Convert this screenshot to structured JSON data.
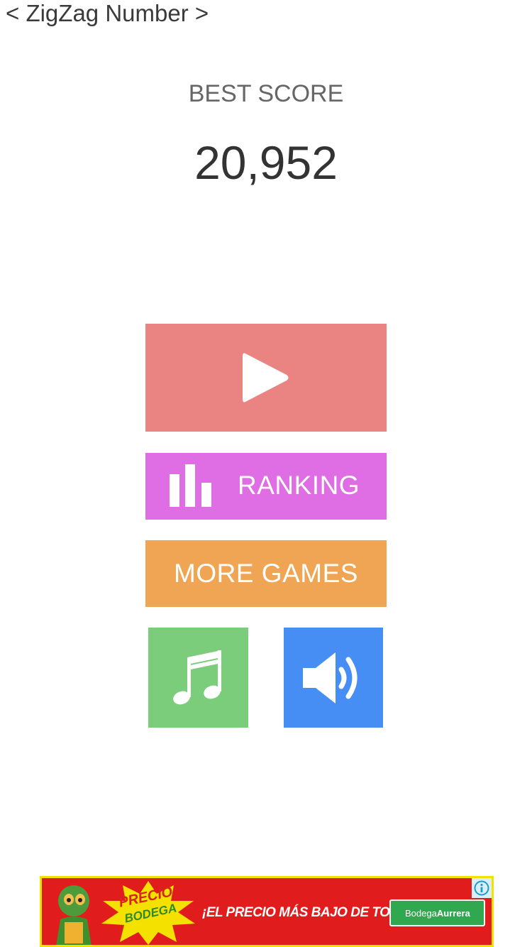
{
  "app": {
    "title": "< ZigZag Number >"
  },
  "score": {
    "label": "BEST SCORE",
    "value": "20,952"
  },
  "buttons": {
    "play": {
      "icon": "play-icon",
      "color": "#e98482"
    },
    "ranking": {
      "label": "RANKING",
      "icon": "bar-chart-icon",
      "color": "#df6de3"
    },
    "more_games": {
      "label": "MORE GAMES",
      "color": "#f0a555"
    },
    "music": {
      "icon": "music-note-icon",
      "color": "#7bcd7b"
    },
    "sound": {
      "icon": "speaker-icon",
      "color": "#468ef4"
    }
  },
  "ad": {
    "slogan": "¡EL PRECIO MÁS BAJO DE TODOS!",
    "burst_line1": "PRECIO",
    "burst_line2": "BODEGA",
    "logo_text": "Bodega",
    "logo_text_bold": "Aurrera",
    "info_icon": "info-icon",
    "colors": {
      "background": "#e01c1c",
      "border": "#f5e100",
      "logo": "#2fa84f"
    }
  }
}
